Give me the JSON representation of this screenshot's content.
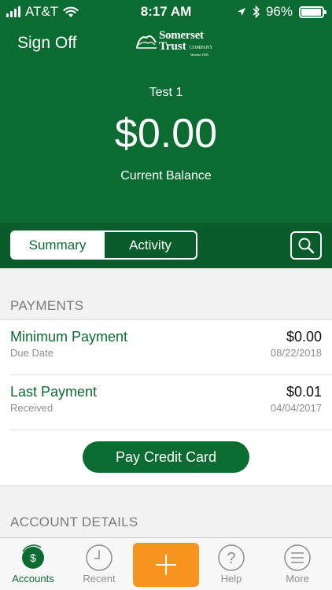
{
  "status": {
    "carrier": "AT&T",
    "time": "8:17 AM",
    "battery": "96%",
    "battery_level": 0.96
  },
  "nav": {
    "signoff_label": "Sign Off",
    "logo": {
      "line1": "Somerset",
      "line2": "Trust",
      "company": "COMPANY",
      "fdic": "Member FDIC"
    }
  },
  "account": {
    "name": "Test 1",
    "balance": "$0.00",
    "balance_label": "Current Balance"
  },
  "tabs": {
    "summary": "Summary",
    "activity": "Activity",
    "active": "Summary"
  },
  "payments": {
    "heading": "PAYMENTS",
    "rows": [
      {
        "title": "Minimum Payment",
        "value": "$0.00",
        "sub": "Due Date",
        "date": "08/22/2018"
      },
      {
        "title": "Last Payment",
        "value": "$0.01",
        "sub": "Received",
        "date": "04/04/2017"
      }
    ],
    "pay_button": "Pay Credit Card"
  },
  "details": {
    "heading": "ACCOUNT DETAILS"
  },
  "bottom_nav": {
    "items": [
      {
        "label": "Accounts",
        "icon": "dollar-icon",
        "active": true
      },
      {
        "label": "Recent",
        "icon": "clock-icon",
        "active": false
      },
      {
        "label": "",
        "icon": "plus-icon",
        "active": false
      },
      {
        "label": "Help",
        "icon": "question-icon",
        "active": false
      },
      {
        "label": "More",
        "icon": "menu-icon",
        "active": false
      }
    ]
  },
  "colors": {
    "brand_green": "#0c6b31",
    "accent_orange": "#f7941d"
  }
}
